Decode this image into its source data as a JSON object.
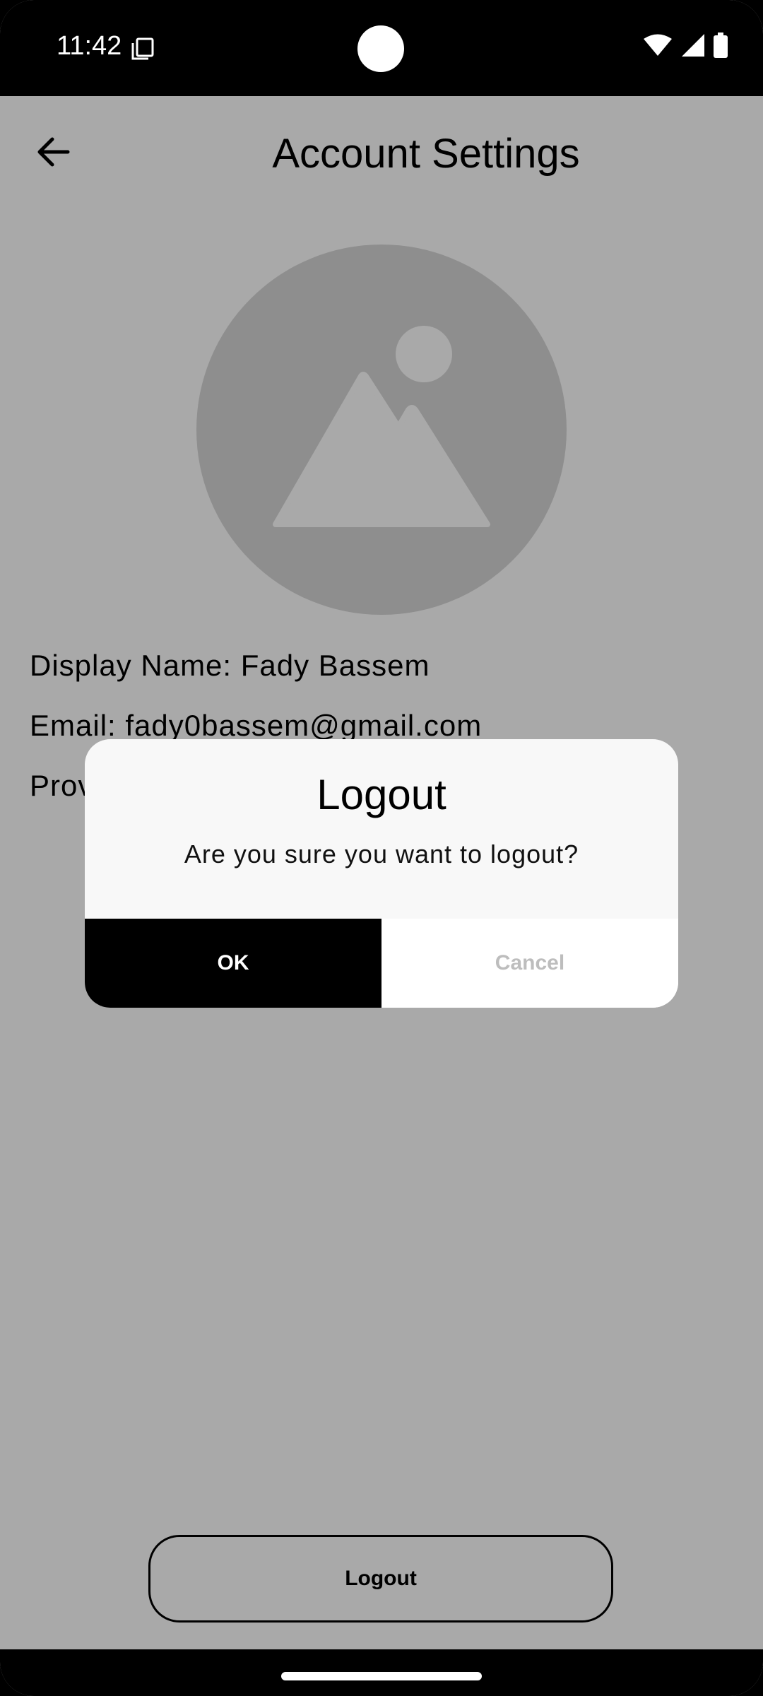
{
  "status_bar": {
    "time": "11:42",
    "icons": [
      "screenshot-icon",
      "wifi-icon",
      "signal-icon",
      "battery-icon"
    ]
  },
  "header": {
    "back_icon": "arrow-back-icon",
    "title": "Account Settings"
  },
  "profile": {
    "avatar_icon": "image-placeholder-icon",
    "display_name": "Display Name: Fady Bassem",
    "email": "Email: fady0bassem@gmail.com",
    "provider_partial": "Prov"
  },
  "dialog": {
    "title": "Logout",
    "message": "Are you sure you want to logout?",
    "ok_label": "OK",
    "cancel_label": "Cancel"
  },
  "footer": {
    "logout_label": "Logout"
  },
  "colors": {
    "scrim": "#a9a9a9",
    "avatar_bg": "#8e8e8e",
    "dialog_bg": "#f8f8f8",
    "ok_bg": "#000000",
    "cancel_text": "#bdbdbd"
  }
}
